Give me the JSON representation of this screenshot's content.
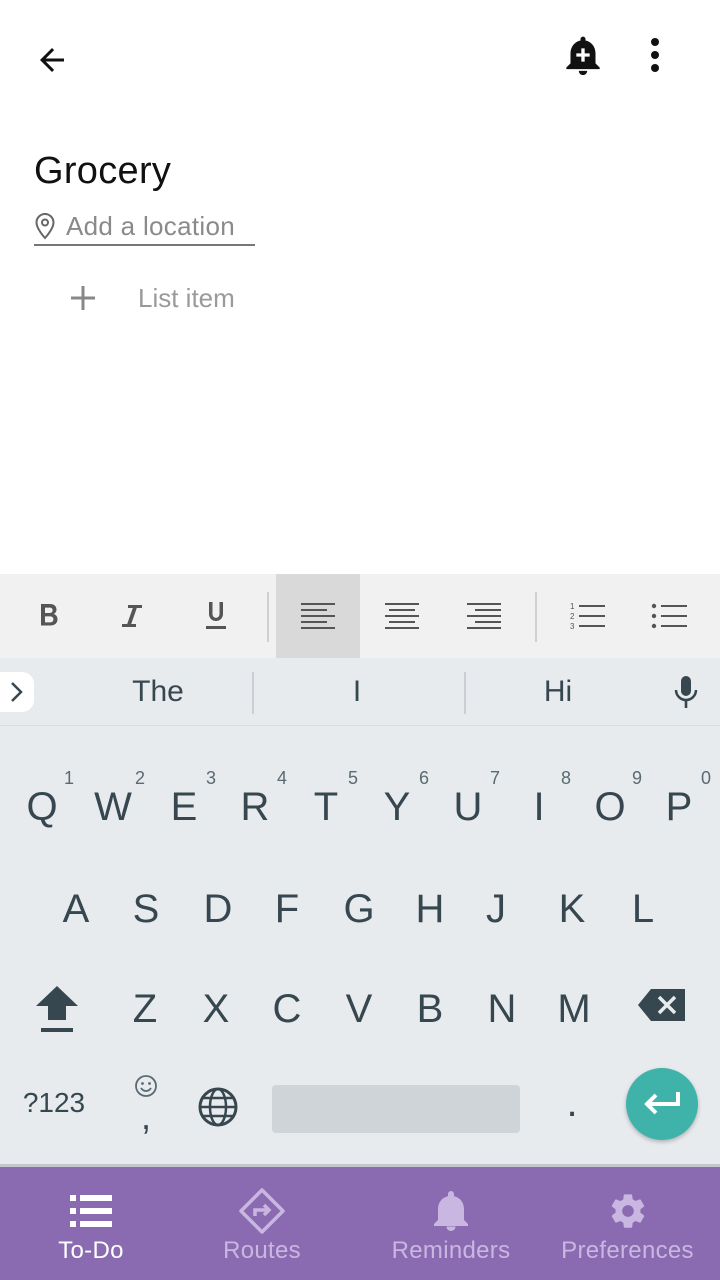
{
  "list": {
    "title": "Grocery",
    "location_placeholder": "Add a location",
    "add_item_placeholder": "List item"
  },
  "keyboard": {
    "suggestions": [
      "The",
      "I",
      "Hi"
    ],
    "row1": [
      {
        "key": "Q",
        "hint": "1"
      },
      {
        "key": "W",
        "hint": "2"
      },
      {
        "key": "E",
        "hint": "3"
      },
      {
        "key": "R",
        "hint": "4"
      },
      {
        "key": "T",
        "hint": "5"
      },
      {
        "key": "Y",
        "hint": "6"
      },
      {
        "key": "U",
        "hint": "7"
      },
      {
        "key": "I",
        "hint": "8"
      },
      {
        "key": "O",
        "hint": "9"
      },
      {
        "key": "P",
        "hint": "0"
      }
    ],
    "row2": [
      "A",
      "S",
      "D",
      "F",
      "G",
      "H",
      "J",
      "K",
      "L"
    ],
    "row3": [
      "Z",
      "X",
      "C",
      "V",
      "B",
      "N",
      "M"
    ],
    "symbols_label": "?123",
    "comma": ",",
    "period": "."
  },
  "bottom_nav": {
    "items": [
      {
        "label": "To-Do",
        "icon": "list-icon",
        "active": true
      },
      {
        "label": "Routes",
        "icon": "directions-icon",
        "active": false
      },
      {
        "label": "Reminders",
        "icon": "bell-icon",
        "active": false
      },
      {
        "label": "Preferences",
        "icon": "gear-icon",
        "active": false
      }
    ]
  },
  "colors": {
    "nav_background": "#8a6bb1",
    "nav_active": "#ffffff",
    "nav_inactive": "#c9b7e1",
    "enter_key": "#3fb3a9",
    "keyboard_background": "#e8ebee",
    "key_text": "#37474f"
  }
}
